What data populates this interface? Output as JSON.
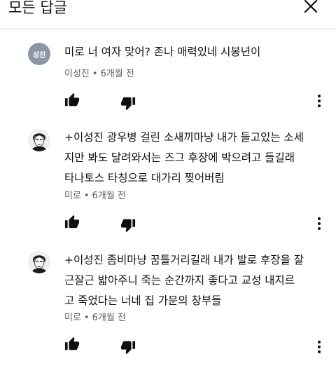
{
  "header": {
    "title": "모든 답글",
    "close_icon": "close-icon"
  },
  "colors": {
    "avatar_bg": "#8a98a6",
    "meta_text": "#606060",
    "icon": "#0f0f0f"
  },
  "comments": [
    {
      "author": "이성진",
      "avatar_initials": "성진",
      "text": "미로 너 여자 맞어? 존나 매력있네 시봉년이",
      "time": "6개월 전",
      "icons": [
        "thumb-up-icon",
        "thumb-down-icon",
        "more-vert-icon"
      ]
    },
    {
      "author": "미로",
      "avatar_initials": "",
      "text_lines": [
        "+이성진 광우병 걸린 소새끼마냥 내가 들고있는 소세",
        "지만 봐도 달려와서는 즈그 후장에 박으려고 들길래",
        "타나토스 타칭으로 대가리 찢어버림"
      ],
      "time": "6개월 전",
      "icons": [
        "thumb-up-icon",
        "thumb-down-icon",
        "more-vert-icon"
      ]
    },
    {
      "author": "미로",
      "avatar_initials": "",
      "text_lines": [
        "+이성진 좀비마냥 꿈틀거리길래 내가 발로 후장을 잘",
        "근잘근 밟아주니 죽는 순간까지 좋다고 교성 내지르",
        "고 죽었다는 너네 집 가문의 창부들"
      ],
      "time": "6개월 전",
      "icons": [
        "thumb-up-icon",
        "thumb-down-icon",
        "more-vert-icon"
      ]
    }
  ]
}
